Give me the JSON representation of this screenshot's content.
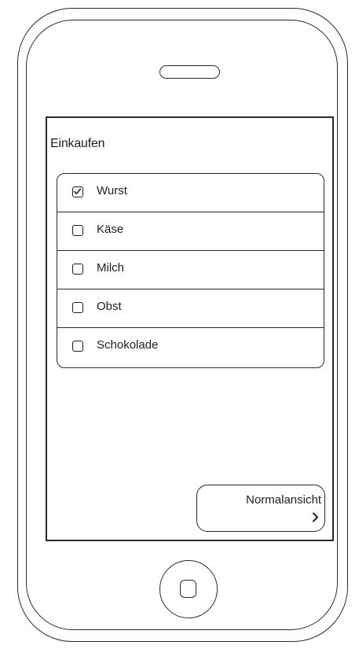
{
  "app": {
    "title": "Einkaufen"
  },
  "list": {
    "items": [
      {
        "label": "Wurst",
        "checked": true
      },
      {
        "label": "Käse",
        "checked": false
      },
      {
        "label": "Milch",
        "checked": false
      },
      {
        "label": "Obst",
        "checked": false
      },
      {
        "label": "Schokolade",
        "checked": false
      }
    ]
  },
  "nav_button": {
    "label": "Normalansicht",
    "icon": "chevron-right-icon"
  },
  "device": {
    "icons": [
      "speaker-slot-icon",
      "home-button-icon"
    ]
  },
  "colors": {
    "stroke": "#2a2a2a",
    "text": "#1e1e1e",
    "background": "#ffffff"
  }
}
